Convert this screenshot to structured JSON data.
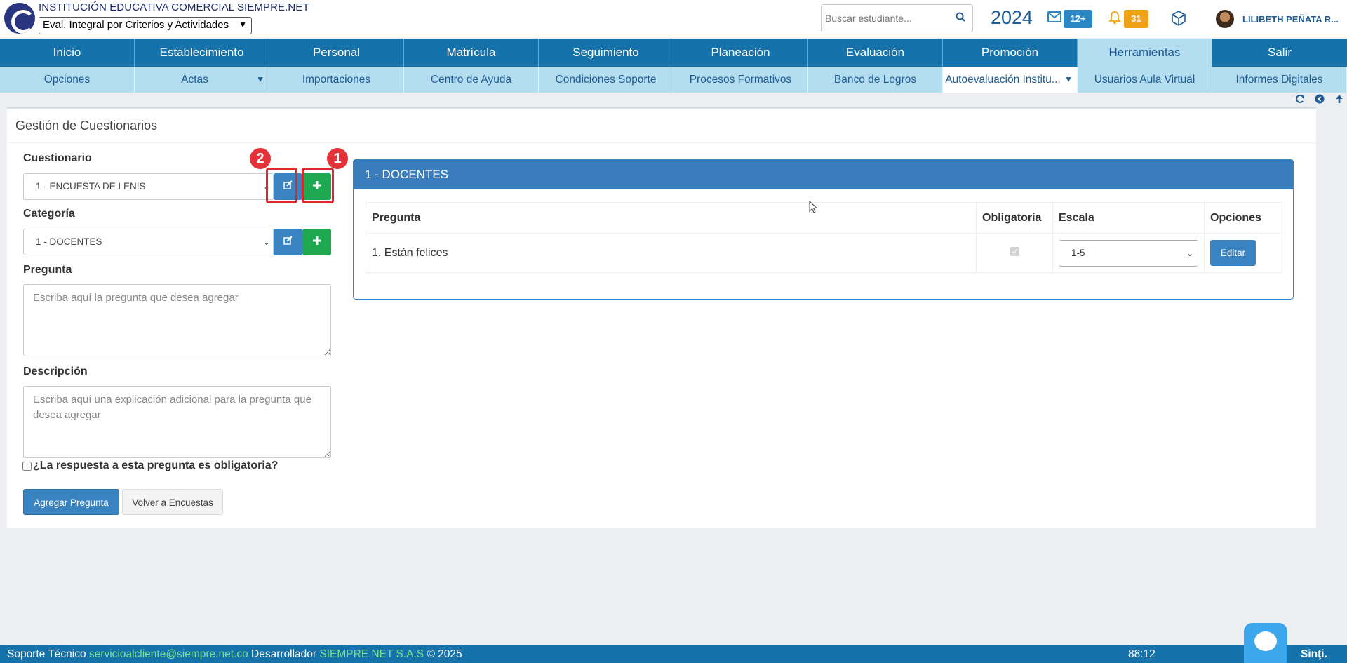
{
  "header": {
    "institution": "INSTITUCIÓN EDUCATIVA COMERCIAL SIEMPRE.NET",
    "period_select": "Eval. Integral por Criterios y Actividades",
    "search_placeholder": "Buscar estudiante...",
    "year": "2024",
    "messages_badge": "12+",
    "notifications_badge": "31",
    "username": "LILIBETH PEÑATA R..."
  },
  "main_nav": [
    {
      "label": "Inicio"
    },
    {
      "label": "Establecimiento"
    },
    {
      "label": "Personal"
    },
    {
      "label": "Matrícula"
    },
    {
      "label": "Seguimiento"
    },
    {
      "label": "Planeación"
    },
    {
      "label": "Evaluación"
    },
    {
      "label": "Promoción"
    },
    {
      "label": "Herramientas"
    },
    {
      "label": "Salir"
    }
  ],
  "sub_nav": [
    {
      "label": "Opciones"
    },
    {
      "label": "Actas"
    },
    {
      "label": "Importaciones"
    },
    {
      "label": "Centro de Ayuda"
    },
    {
      "label": "Condiciones Soporte"
    },
    {
      "label": "Procesos Formativos"
    },
    {
      "label": "Banco de Logros"
    },
    {
      "label": "Autoevaluación Institu..."
    },
    {
      "label": "Usuarios Aula Virtual"
    },
    {
      "label": "Informes Digitales"
    }
  ],
  "panel": {
    "title": "Gestión de Cuestionarios",
    "cuestionario_label": "Cuestionario",
    "cuestionario_value": "1 - ENCUESTA DE LENIS",
    "categoria_label": "Categoría",
    "categoria_value": "1 - DOCENTES",
    "pregunta_label": "Pregunta",
    "pregunta_placeholder": "Escriba aquí la pregunta que desea agregar",
    "descripcion_label": "Descripción",
    "descripcion_placeholder": "Escriba aquí una explicación adicional para la pregunta que desea agregar",
    "obligatoria_label": "¿La respuesta a esta pregunta es obligatoria?",
    "add_question_button": "Agregar Pregunta",
    "back_button": "Volver a Encuestas",
    "callout_1": "1",
    "callout_2": "2"
  },
  "category_card": {
    "title": "1 - DOCENTES",
    "columns": [
      "Pregunta",
      "Obligatoria",
      "Escala",
      "Opciones"
    ],
    "rows": [
      {
        "question": "1. Están felices",
        "required": true,
        "scale": "1-5",
        "action": "Editar"
      }
    ]
  },
  "footer": {
    "support_label": "Soporte Técnico",
    "support_email": "servicioalcliente@siempre.net.co",
    "developer_label": "Desarrollador",
    "developer_name": "SIEMPRE.NET S.A.S",
    "copyright": "© 2025",
    "timer": "88:12",
    "brand": "Sinţi."
  },
  "colors": {
    "nav_bg": "#1672ab",
    "subnav_bg": "#b4def0",
    "primary_button": "#3a83c1",
    "success_button": "#1ea84f",
    "callout_red": "#e53238",
    "badge_orange": "#f0a217"
  }
}
